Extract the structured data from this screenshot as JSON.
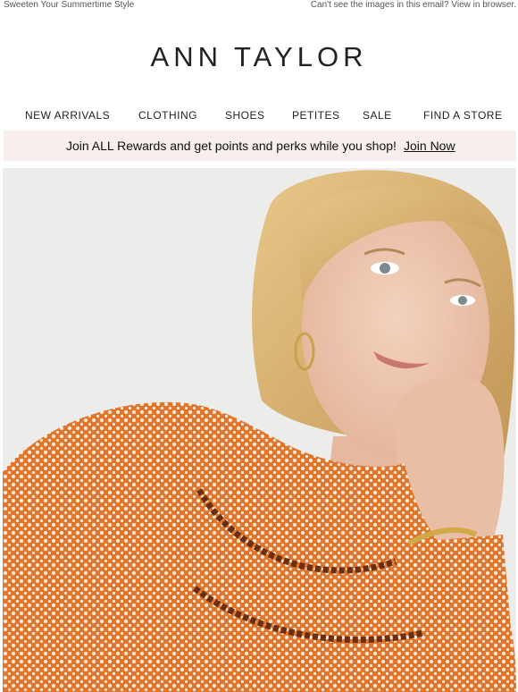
{
  "preheader": {
    "tagline": "Sweeten Your Summertime Style",
    "view_in_browser": "Can't see the images in this email? View in browser."
  },
  "brand": {
    "logo_text": "ANN TAYLOR"
  },
  "nav": {
    "items": [
      "NEW ARRIVALS",
      "CLOTHING",
      "SHOES",
      "PETITES",
      "SALE",
      "FIND A STORE"
    ]
  },
  "rewards": {
    "message": "Join ALL Rewards and get points and perks while you shop!",
    "cta": "Join Now",
    "bg_color": "#f7eeed"
  },
  "hero": {
    "icon": "hero-photo-woman-orange-dotted-blouse",
    "colors": {
      "blouse": "#e0752c",
      "background": "#ececea",
      "hair": "#d6ad6a"
    }
  }
}
